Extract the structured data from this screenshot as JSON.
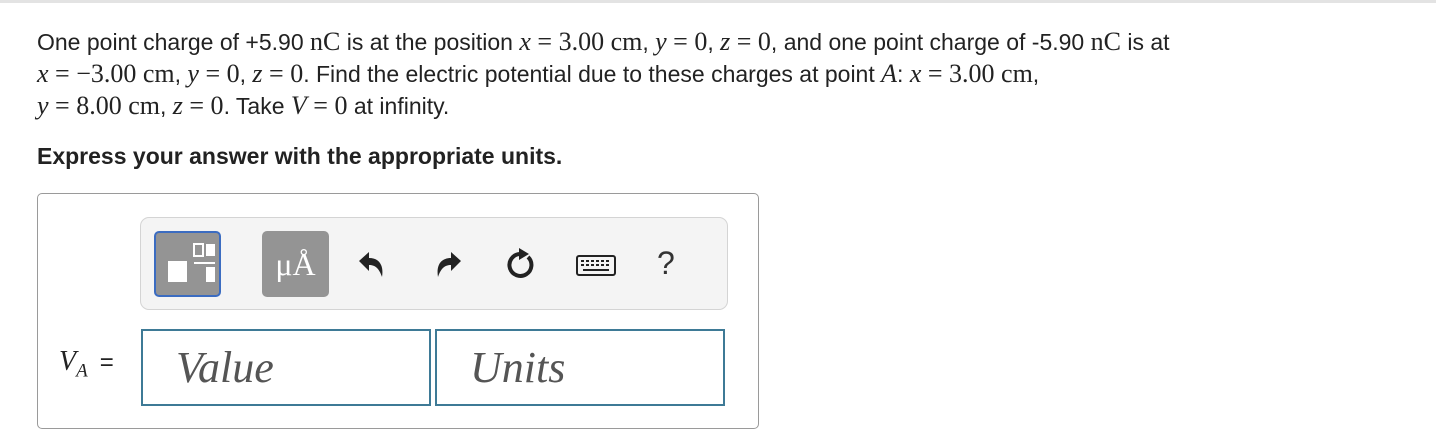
{
  "problem": {
    "l1_a": "One point charge of +5.90 ",
    "l1_b": "nC",
    "l1_c": " is at the position ",
    "l1_d": "x",
    "l1_e": " = 3.00 cm",
    "l1_f": ", ",
    "l1_g": "y",
    "l1_h": " = 0",
    "l1_i": ", ",
    "l1_j": "z",
    "l1_k": " = 0",
    "l1_l": ", and one point charge of -5.90 ",
    "l1_m": "nC",
    "l1_n": " is at",
    "l2_a": "x",
    "l2_b": " = −3.00 cm",
    "l2_c": ", ",
    "l2_d": "y",
    "l2_e": " = 0",
    "l2_f": ", ",
    "l2_g": "z",
    "l2_h": " = 0",
    "l2_i": ". Find the electric potential due to these charges at point ",
    "l2_j": "A",
    "l2_k": ": ",
    "l2_l": "x",
    "l2_m": " = 3.00 cm",
    "l2_n": ",",
    "l3_a": "y",
    "l3_b": " = 8.00 cm",
    "l3_c": ", ",
    "l3_d": "z",
    "l3_e": " = 0",
    "l3_f": ". Take ",
    "l3_g": "V",
    "l3_h": " = 0",
    "l3_i": " at infinity."
  },
  "instruction": "Express your answer with the appropriate units.",
  "toolbar": {
    "units_label": "μÅ",
    "help_label": "?",
    "icons": [
      "templates-icon",
      "units-icon",
      "undo-icon",
      "redo-icon",
      "reset-icon",
      "keyboard-icon",
      "help-icon"
    ]
  },
  "answer": {
    "var_name": "V",
    "var_sub": "A",
    "equals": "=",
    "value_placeholder": "Value",
    "units_placeholder": "Units",
    "value": "",
    "units": ""
  },
  "colors": {
    "field_border": "#3e7a96",
    "toolbar_button": "#949494",
    "focus_ring": "#3b6cc1"
  }
}
